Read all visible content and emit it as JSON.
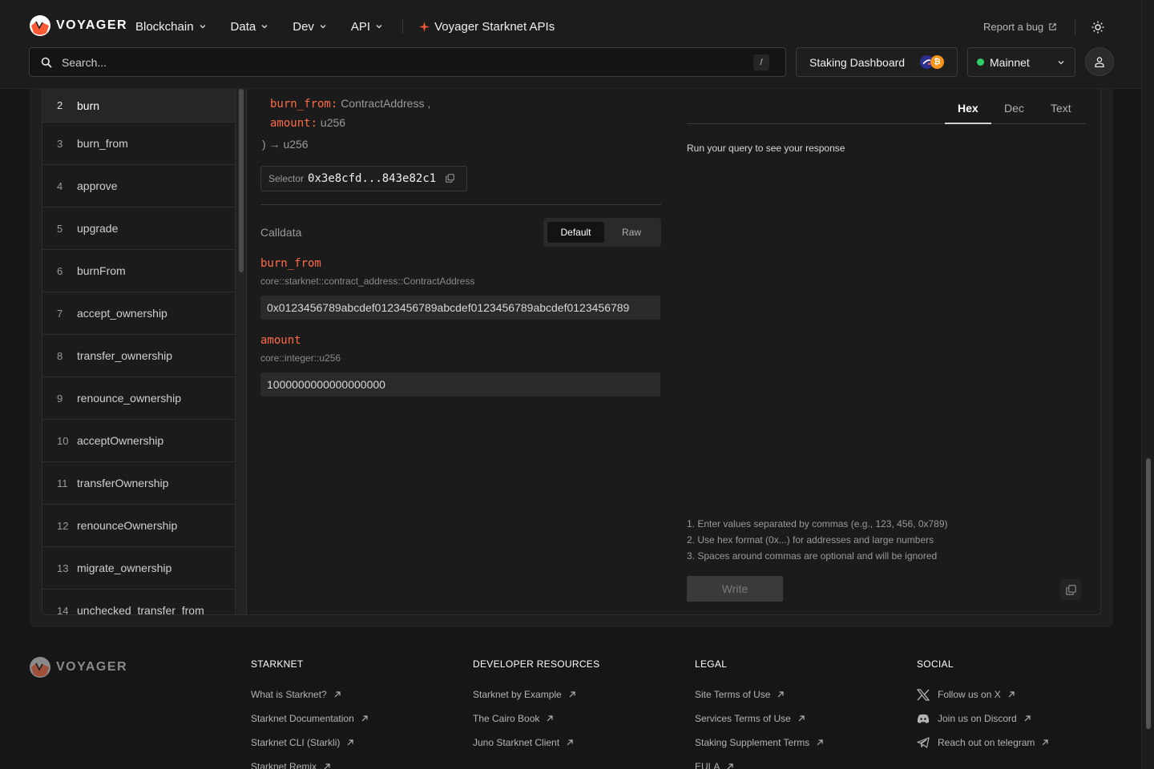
{
  "header": {
    "logo_text": "VOYAGER",
    "nav": [
      {
        "label": "Blockchain"
      },
      {
        "label": "Data"
      },
      {
        "label": "Dev"
      },
      {
        "label": "API"
      }
    ],
    "promo_label": "Voyager Starknet APIs",
    "report_bug": "Report a bug",
    "search_placeholder": "Search...",
    "search_shortcut": "/",
    "staking_label": "Staking Dashboard",
    "network_label": "Mainnet",
    "colors": {
      "accent": "#ff6b4a",
      "network_ok": "#2fd06b"
    }
  },
  "functions": [
    {
      "num": "2",
      "name": "burn"
    },
    {
      "num": "3",
      "name": "burn_from"
    },
    {
      "num": "4",
      "name": "approve"
    },
    {
      "num": "5",
      "name": "upgrade"
    },
    {
      "num": "6",
      "name": "burnFrom"
    },
    {
      "num": "7",
      "name": "accept_ownership"
    },
    {
      "num": "8",
      "name": "transfer_ownership"
    },
    {
      "num": "9",
      "name": "renounce_ownership"
    },
    {
      "num": "10",
      "name": "acceptOwnership"
    },
    {
      "num": "11",
      "name": "transferOwnership"
    },
    {
      "num": "12",
      "name": "renounceOwnership"
    },
    {
      "num": "13",
      "name": "migrate_ownership"
    },
    {
      "num": "14",
      "name": "unchecked_transfer_from"
    }
  ],
  "signature": {
    "params": [
      {
        "key": "burn_from:",
        "type": "ContractAddress ,"
      },
      {
        "key": "amount:",
        "type": "u256"
      }
    ],
    "return_line": ") → u256"
  },
  "selector": {
    "label": "Selector",
    "value": "0x3e8cfd...843e82c1"
  },
  "calldata": {
    "label": "Calldata",
    "mode_default": "Default",
    "mode_raw": "Raw",
    "args": [
      {
        "name": "burn_from",
        "type": "core::starknet::contract_address::ContractAddress",
        "value": "0x0123456789abcdef0123456789abcdef0123456789abcdef0123456789"
      },
      {
        "name": "amount",
        "type": "core::integer::u256",
        "value": "1000000000000000000"
      }
    ]
  },
  "response": {
    "tabs": [
      "Hex",
      "Dec",
      "Text"
    ],
    "active_tab": "Hex",
    "message": "Run your query to see your response",
    "hints": [
      "1. Enter values separated by commas (e.g., 123, 456, 0x789)",
      "2. Use hex format (0x...) for addresses and large numbers",
      "3. Spaces around commas are optional and will be ignored"
    ],
    "write_label": "Write"
  },
  "footer": {
    "logo_text": "VOYAGER",
    "columns": [
      {
        "title": "STARKNET",
        "links": [
          "What is Starknet?",
          "Starknet Documentation",
          "Starknet CLI (Starkli)",
          "Starknet Remix"
        ]
      },
      {
        "title": "DEVELOPER RESOURCES",
        "links": [
          "Starknet by Example",
          "The Cairo Book",
          "Juno Starknet Client"
        ]
      },
      {
        "title": "LEGAL",
        "links": [
          "Site Terms of Use",
          "Services Terms of Use",
          "Staking Supplement Terms",
          "EULA"
        ]
      },
      {
        "title": "SOCIAL",
        "links": [
          "Follow us on X",
          "Join us on Discord",
          "Reach out on telegram"
        ]
      }
    ]
  }
}
